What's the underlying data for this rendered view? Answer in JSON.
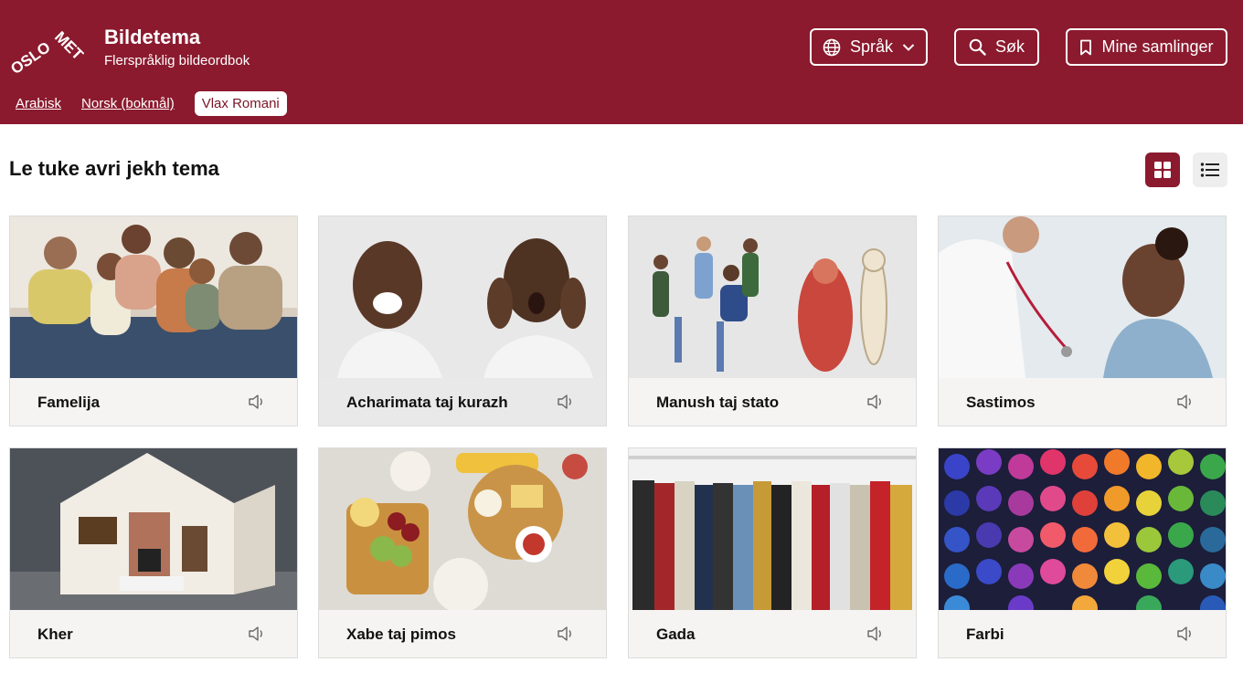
{
  "header": {
    "logo_text": "OSLOMET",
    "title": "Bildetema",
    "subtitle": "Flerspråklig bildeordbok",
    "language_button": "Språk",
    "search_button": "Søk",
    "collections_button": "Mine samlinger"
  },
  "language_tabs": [
    {
      "label": "Arabisk",
      "active": false
    },
    {
      "label": "Norsk (bokmål)",
      "active": false
    },
    {
      "label": "Vlax Romani",
      "active": true
    }
  ],
  "main": {
    "title": "Le tuke avri jekh tema",
    "view_modes": [
      "grid-view-icon",
      "list-view-icon"
    ],
    "active_view": "grid"
  },
  "themes": [
    {
      "label": "Famelija",
      "image": "family-photo"
    },
    {
      "label": "Acharimata taj kurazh",
      "image": "emotions-photo"
    },
    {
      "label": "Manush taj stato",
      "image": "body-photo"
    },
    {
      "label": "Sastimos",
      "image": "doctor-photo"
    },
    {
      "label": "Kher",
      "image": "house-photo"
    },
    {
      "label": "Xabe taj pimos",
      "image": "food-photo"
    },
    {
      "label": "Gada",
      "image": "clothes-photo"
    },
    {
      "label": "Farbi",
      "image": "colors-photo"
    }
  ],
  "colors": {
    "brand": "#8b1a2e",
    "card_bg": "#f5f4f2"
  }
}
